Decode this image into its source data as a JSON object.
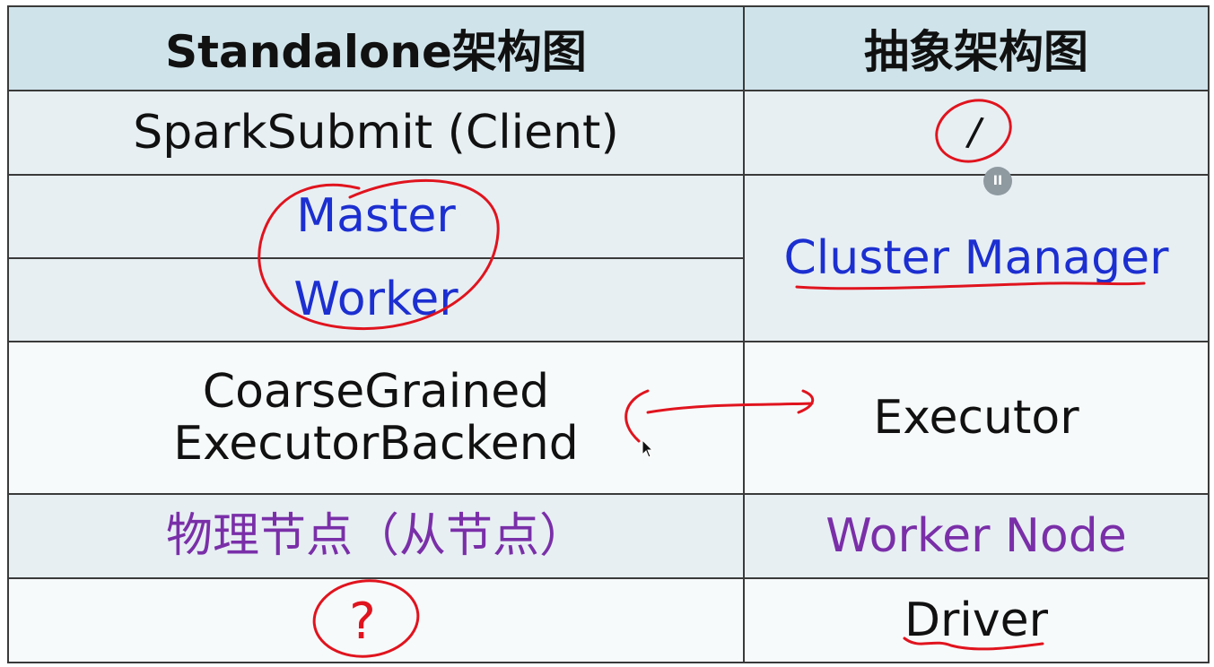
{
  "header": {
    "left": "Standalone架构图",
    "right": "抽象架构图"
  },
  "rows": [
    {
      "left": "SparkSubmit (Client)",
      "right": ""
    },
    {
      "left_a": "Master",
      "left_b": "Worker",
      "right": "Cluster Manager"
    },
    {
      "left_line1": "CoarseGrained",
      "left_line2": "ExecutorBackend",
      "right": "Executor"
    },
    {
      "left": "物理节点（从节点）",
      "right": "Worker Node"
    },
    {
      "left": "",
      "right": "Driver"
    }
  ],
  "annotations": {
    "question_mark": "?",
    "slash_mark": "/"
  },
  "controls": {
    "pause_glyph": "II"
  },
  "colors": {
    "header_bg": "#cfe3ea",
    "cell_bg": "#e7eff3",
    "blue_text": "#1c2fd0",
    "purple_text": "#7a2fa8",
    "annotation_red": "#e0141e"
  }
}
